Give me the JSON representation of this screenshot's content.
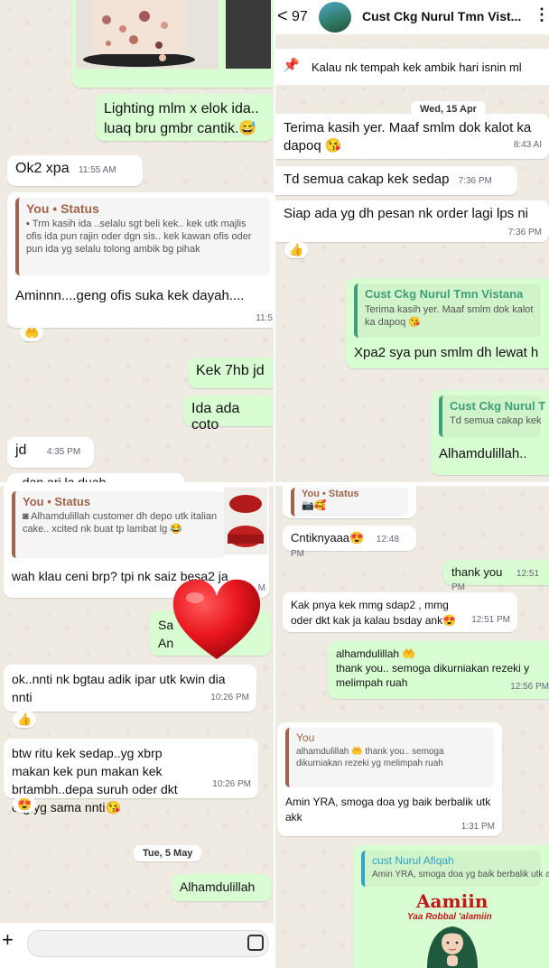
{
  "panel1": {
    "caption_line1": "Lighting mlm x elok ida..",
    "caption_line2": "luaq bru gmbr cantik.😅",
    "msg_ok": "Ok2 xpa",
    "msg_ok_time": "11:55 AM",
    "quote_author": "You • Status",
    "quote_text": "Trm kasih ida ..selalu sgt beli kek.. kek utk majlis ofis ida pun rajin oder dgn sis.. kek kawan ofis oder pun ida yg selalu tolong ambik bg pihak",
    "reply_text": "Aminnn....geng ofis suka kek dayah....",
    "reply_time": "11:5",
    "react1": "🤲",
    "out1": "Kek 7hb jd",
    "out2": "Ida ada coto",
    "msg_jd": "jd",
    "msg_jd_time": "4:35 PM",
    "cut_text": "..dan ari la duah"
  },
  "panel2": {
    "header": {
      "back": "<",
      "unread": "97",
      "name": "Cust Ckg Nurul Tmn Vist..."
    },
    "pinned": "Kalau nk tempah kek ambik hari isnin ml",
    "date_chip": "Wed, 15 Apr",
    "msg1": "Terima kasih yer. Maaf smlm dok kalot ka dapoq 😘",
    "msg1_time": "8:43 AI",
    "msg2": "Td semua cakap kek sedap",
    "msg2_time": "7:36 PM",
    "msg3": "Siap ada yg dh pesan nk order lagi lps ni",
    "msg3_time": "7:36 PM",
    "react1": "👍",
    "quote1_author": "Cust Ckg Nurul Tmn Vistana",
    "quote1_text": "Terima kasih yer. Maaf smlm dok kalot ka dapoq 😘",
    "reply1": "Xpa2 sya pun smlm dh lewat h",
    "quote2_author": "Cust Ckg Nurul T",
    "quote2_text": "Td semua cakap kek",
    "reply2": "Alhamdulillah.."
  },
  "panel3": {
    "quote_author": "You • Status",
    "quote_text": "Alhamdulillah customer dh depo utk italian cake.. xcited nk buat tp lambat lg 😂",
    "msg1": "wah klau ceni brp? tpi nk saiz besa2 ja",
    "msg1_time": "M",
    "out1_a": "Sa",
    "out1_b": "An",
    "msg2": "ok..nnti nk bgtau adik ipar utk kwin dia nnti",
    "msg2_time": "10:26 PM",
    "react1": "👍",
    "msg3": "btw ritu kek sedap..yg xbrp makan kek pun makan kek brtambh..depa suruh oder dkt org yg sama nnti😘",
    "msg3_time": "10:26 PM",
    "react2": "😍",
    "date_chip": "Tue, 5 May",
    "out2": "Alhamdulillah",
    "input_plus": "+"
  },
  "panel4": {
    "status_label": "You • Status",
    "status_emoji": "📷🥰",
    "msg1": "Cntiknyaaa😍",
    "msg1_time": "12:48 PM",
    "out1": "thank you",
    "out1_time": "12:51 PM",
    "msg2": "Kak pnya kek mmg sdap2 , mmg oder dkt kak ja kalau bsday ank😍",
    "msg2_time": "12:51 PM",
    "out2_line1": "alhamdulillah 🤲",
    "out2_line2": "thank you.. semoga dikurniakan rezeki y melimpah ruah",
    "out2_time": "12:56 PM",
    "quote_author": "You",
    "quote_text": "alhamdulillah 🤲 thank you.. semoga dikurniakan rezeki yg melimpah ruah",
    "reply": "Amin YRA, smoga doa yg baik berbalik utk akk",
    "reply_time": "1:31 PM",
    "quote2_author": "cust Nurul Afiqah",
    "quote2_text": "Amin YRA, smoga doa yg baik berbalik utk a",
    "sticker_title": "Aamiin",
    "sticker_sub": "Yaa Robbal 'alamiin"
  },
  "colors": {
    "chat_bg": "#efeae2",
    "incoming": "#ffffff",
    "outgoing": "#d9fdd3",
    "quote_you": "#a0644a",
    "quote_cust": "#3f9f7a",
    "quote_afiqah": "#35a0c8",
    "heart": "#e8141c",
    "sticker_text": "#c01818"
  }
}
